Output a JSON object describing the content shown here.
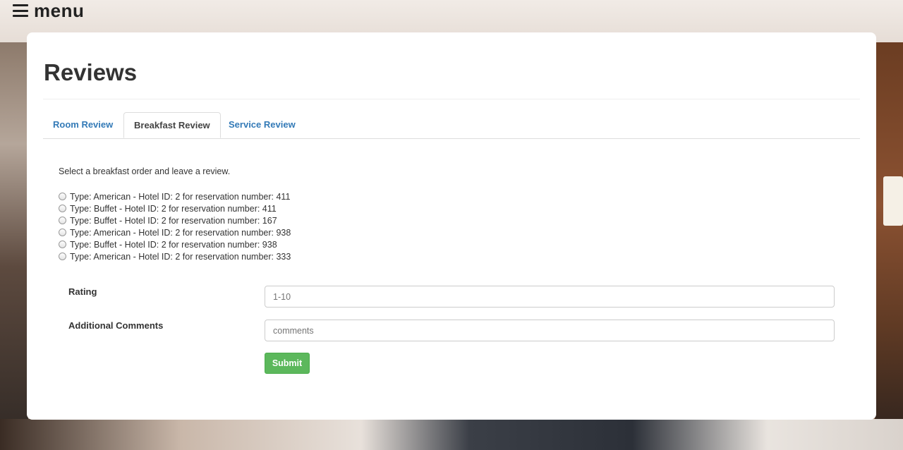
{
  "header": {
    "menu_label": "menu"
  },
  "page": {
    "title": "Reviews"
  },
  "tabs": [
    {
      "label": "Room Review",
      "active": false
    },
    {
      "label": "Breakfast Review",
      "active": true
    },
    {
      "label": "Service Review",
      "active": false
    }
  ],
  "breakfast": {
    "instructions": "Select a breakfast order and leave a review.",
    "options": [
      "Type: American - Hotel ID: 2 for reservation number: 411",
      "Type: Buffet - Hotel ID: 2 for reservation number: 411",
      "Type: Buffet - Hotel ID: 2 for reservation number: 167",
      "Type: American - Hotel ID: 2 for reservation number: 938",
      "Type: Buffet - Hotel ID: 2 for reservation number: 938",
      "Type: American - Hotel ID: 2 for reservation number: 333"
    ]
  },
  "form": {
    "rating_label": "Rating",
    "rating_placeholder": "1-10",
    "comments_label": "Additional Comments",
    "comments_placeholder": "comments",
    "submit_label": "Submit"
  },
  "colors": {
    "link": "#337ab7",
    "submit": "#5cb85c"
  },
  "icons": {
    "menu": "hamburger-icon"
  }
}
